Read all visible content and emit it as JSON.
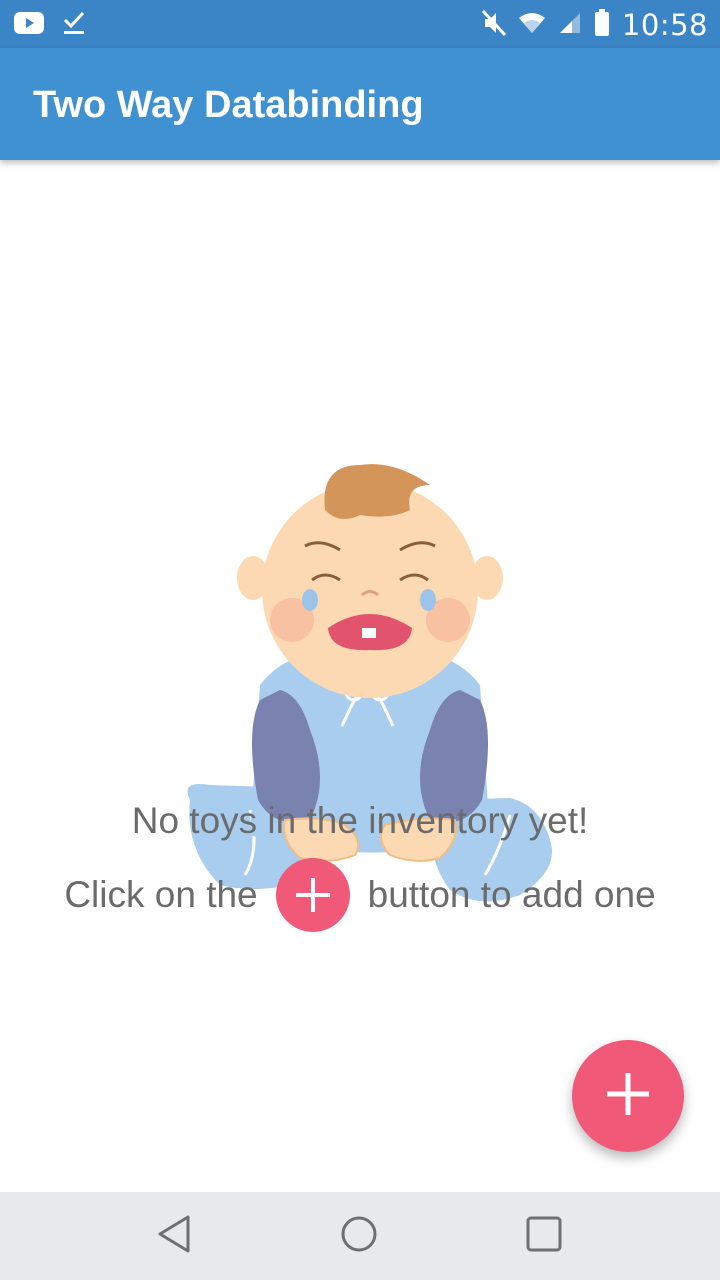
{
  "status_bar": {
    "time": "10:58",
    "left_icons": [
      "youtube-icon",
      "download-done-icon"
    ],
    "right_icons": [
      "mute-icon",
      "wifi-icon",
      "signal-icon",
      "battery-icon"
    ]
  },
  "app_bar": {
    "title": "Two Way Databinding",
    "color": "#3f91d2"
  },
  "empty_state": {
    "illustration": "crying-baby-illustration",
    "line1": "No toys in the inventory yet!",
    "line2_prefix": "Click on the",
    "line2_suffix": "button to add one"
  },
  "fab": {
    "icon": "plus-icon",
    "color": "#f05a78"
  },
  "nav_bar": {
    "buttons": [
      "back-icon",
      "home-icon",
      "recents-icon"
    ]
  }
}
